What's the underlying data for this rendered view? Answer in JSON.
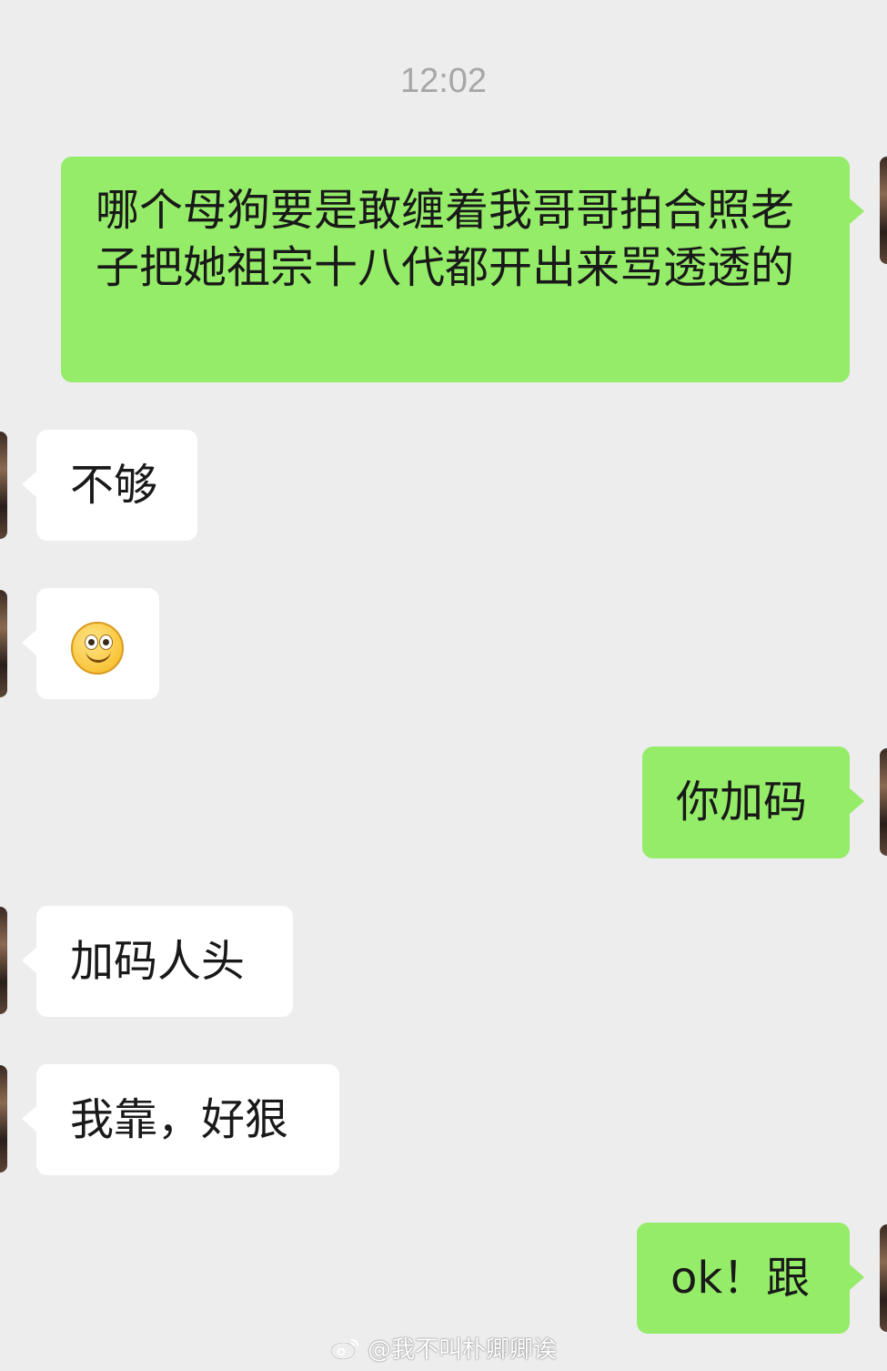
{
  "timestamp": "12:02",
  "messages": [
    {
      "side": "out",
      "text": "哪个母狗要是敢缠着我哥哥拍合照老子把她祖宗十八代都开出来骂透透的"
    },
    {
      "side": "in",
      "text": "不够"
    },
    {
      "side": "in",
      "emoji": "smile-emoji"
    },
    {
      "side": "out",
      "text": "你加码"
    },
    {
      "side": "in",
      "text": "加码人头"
    },
    {
      "side": "in",
      "text": "我靠，好狠"
    },
    {
      "side": "out",
      "text": "ok！跟"
    }
  ],
  "watermark": {
    "text": "@我不叫朴卿卿诶",
    "icon": "weibo-icon"
  },
  "colors": {
    "background": "#ededed",
    "outgoing": "#95ec69",
    "incoming": "#ffffff",
    "text": "#191919",
    "timestamp": "#a7a7a7"
  }
}
